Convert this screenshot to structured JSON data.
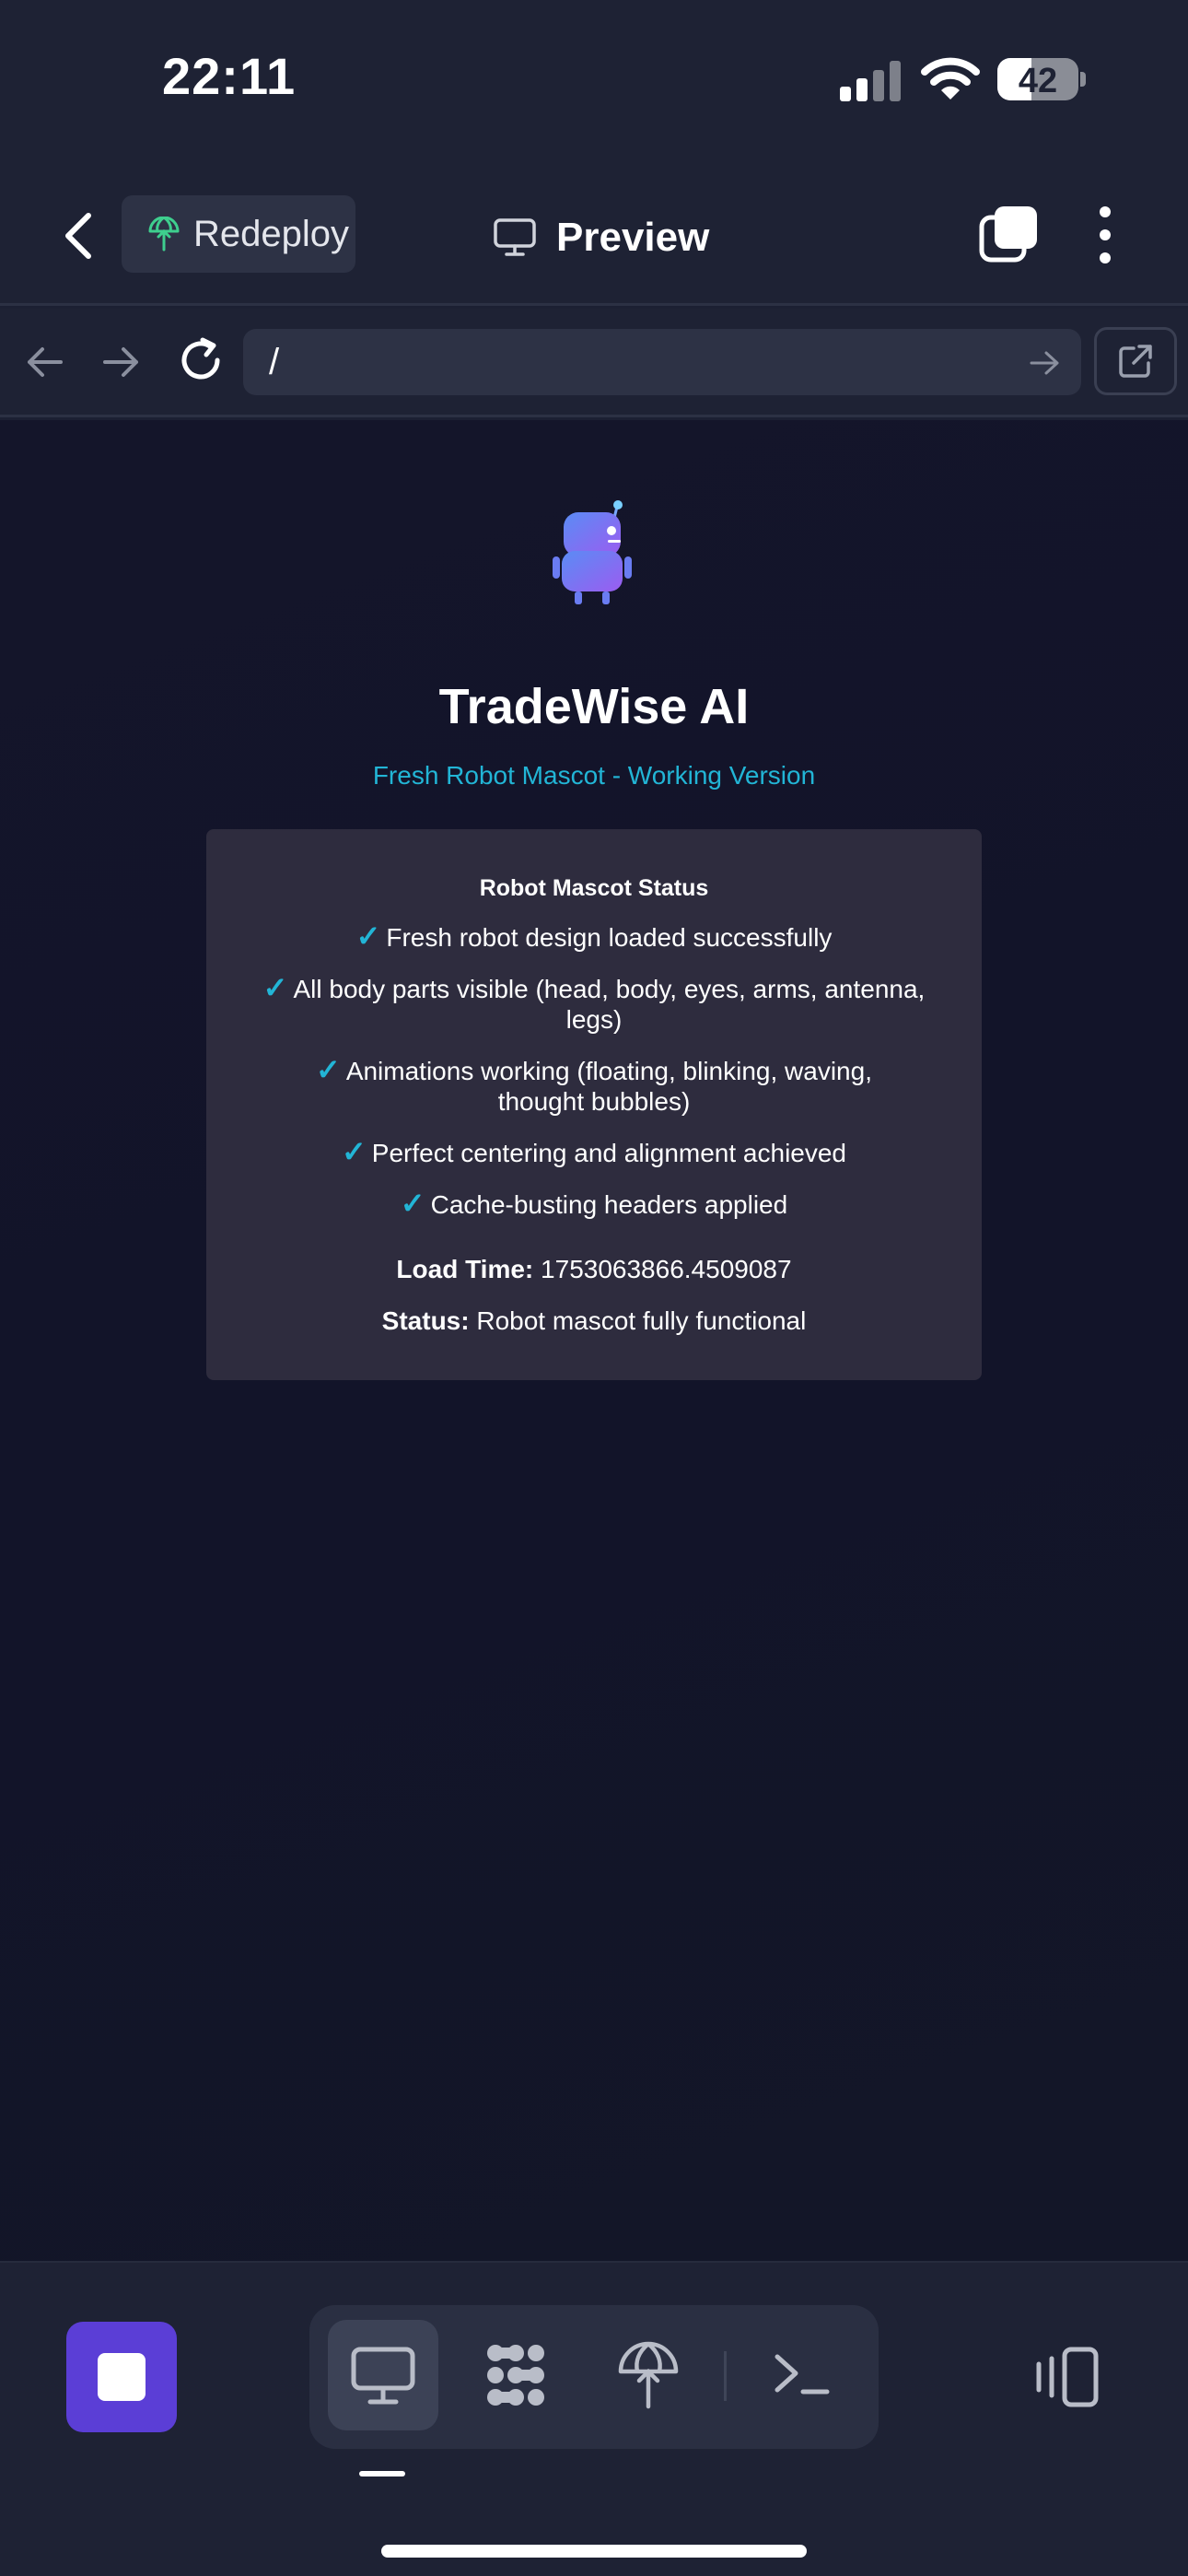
{
  "status_bar": {
    "time": "22:11",
    "battery_level": "42",
    "battery_fraction": 0.42
  },
  "header": {
    "redeploy_label": "Redeploy",
    "title": "Preview"
  },
  "url_bar": {
    "url": "/"
  },
  "page": {
    "title": "TradeWise AI",
    "subtitle": "Fresh Robot Mascot - Working Version",
    "card": {
      "title": "Robot Mascot Status",
      "check_symbol": "✓",
      "checks": [
        "Fresh robot design loaded successfully",
        "All body parts visible (head, body, eyes, arms, antenna, legs)",
        "Animations working (floating, blinking, waving, thought bubbles)",
        "Perfect centering and alignment achieved",
        "Cache-busting headers applied"
      ],
      "load_time_label": "Load Time:",
      "load_time_value": "1753063866.4509087",
      "status_label": "Status:",
      "status_value": "Robot mascot fully functional"
    }
  },
  "bottom_bar": {
    "tools": [
      "preview-icon",
      "shell-cluster-icon",
      "deploy-icon",
      "terminal-icon"
    ],
    "active_tool": "preview-icon"
  },
  "colors": {
    "accent": "#22b5d6",
    "stop_button": "#5b3ed6",
    "background": "#1c2033",
    "card": "#2e2c3e"
  }
}
